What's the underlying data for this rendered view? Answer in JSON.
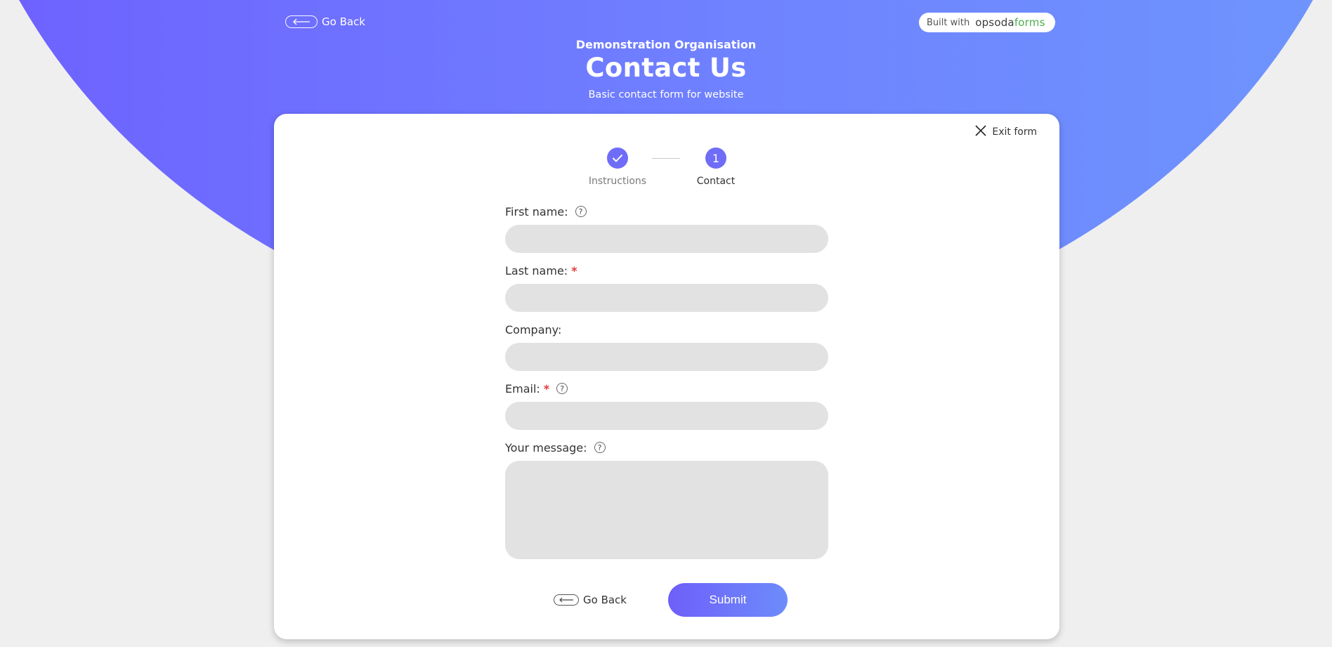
{
  "header": {
    "back_label": "Go Back",
    "built_with_label": "Built with",
    "brand_part1": "opsoda",
    "brand_part2": "forms",
    "organisation": "Demonstration Organisation",
    "title": "Contact Us",
    "subtitle": "Basic contact form for website"
  },
  "card": {
    "exit_label": "Exit form",
    "steps": [
      {
        "label": "Instructions",
        "state": "completed",
        "icon": "check-icon"
      },
      {
        "label": "Contact",
        "state": "current",
        "number": "1"
      }
    ],
    "fields": [
      {
        "label": "First name:",
        "required": false,
        "help": true,
        "value": ""
      },
      {
        "label": "Last name:",
        "required": true,
        "help": false,
        "value": ""
      },
      {
        "label": "Company:",
        "required": false,
        "help": false,
        "value": ""
      },
      {
        "label": "Email:",
        "required": true,
        "help": true,
        "value": ""
      },
      {
        "label": "Your message:",
        "required": false,
        "help": true,
        "value": "",
        "multiline": true
      }
    ],
    "required_marker": "*",
    "help_marker": "?",
    "back_label": "Go Back",
    "submit_label": "Submit"
  },
  "colors": {
    "accent": "#6f6df7",
    "hero_gradient_start": "#6e5fff",
    "hero_gradient_end": "#6e96fd",
    "required": "#e23a3a",
    "brand_green": "#4cae4f"
  }
}
